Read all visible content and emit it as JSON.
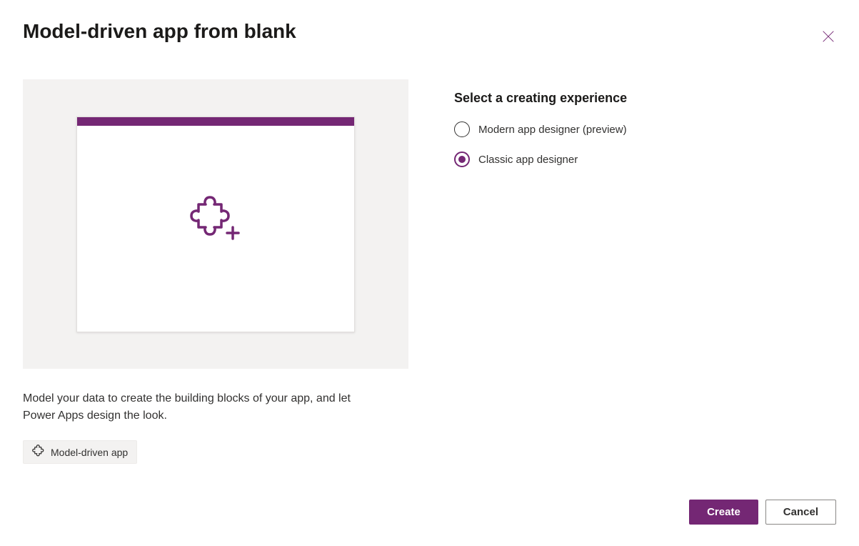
{
  "dialog": {
    "title": "Model-driven app from blank",
    "description": "Model your data to create the building blocks of your app, and let Power Apps design the look.",
    "tag_label": "Model-driven app"
  },
  "options": {
    "heading": "Select a creating experience",
    "items": [
      {
        "label": "Modern app designer (preview)",
        "selected": false
      },
      {
        "label": "Classic app designer",
        "selected": true
      }
    ]
  },
  "footer": {
    "create_label": "Create",
    "cancel_label": "Cancel"
  },
  "colors": {
    "accent": "#742774"
  }
}
